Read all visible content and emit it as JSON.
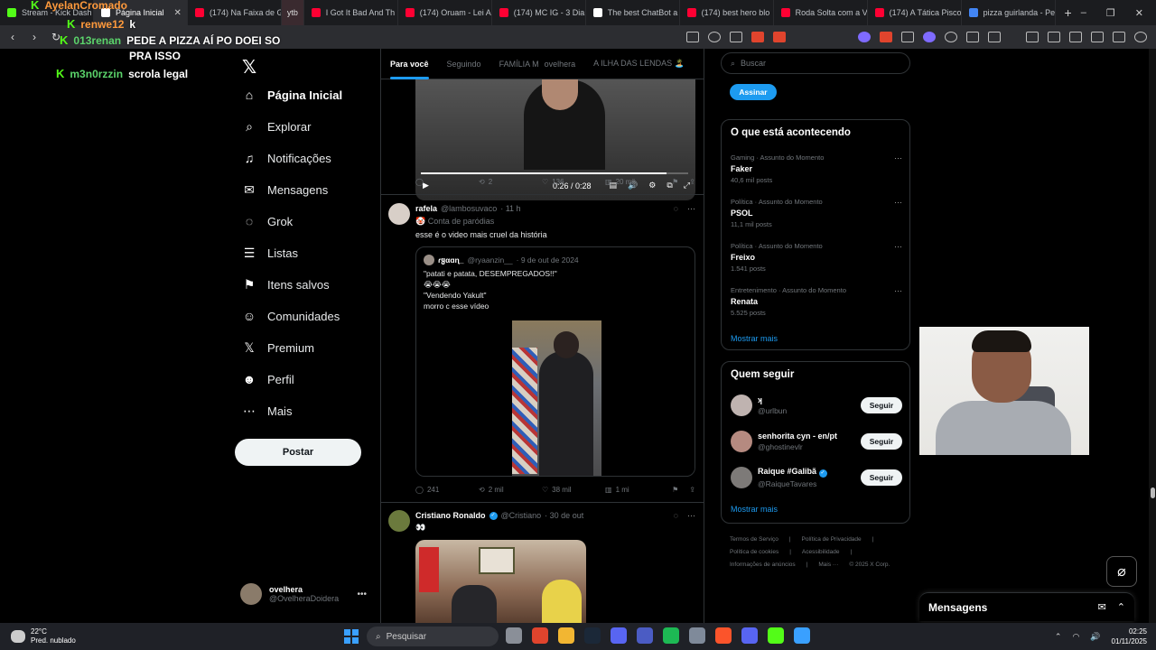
{
  "browser": {
    "tabs": [
      {
        "label": "Stream - Kick Dash",
        "color": "#53fc18"
      },
      {
        "label": "Página Inicial",
        "color": "#ffffff",
        "active": true
      },
      {
        "label": "(174) Na Faixa de G",
        "color": "#ff0033"
      },
      {
        "label": "ytb",
        "color": "#ff0033"
      },
      {
        "label": "I Got It Bad And Th",
        "color": "#ff0033"
      },
      {
        "label": "(174) Oruam - Lei A",
        "color": "#ff0033"
      },
      {
        "label": "(174) MC IG - 3 Dia",
        "color": "#ff0033"
      },
      {
        "label": "The best ChatBot a",
        "color": "#ffffff"
      },
      {
        "label": "(174) best hero blo",
        "color": "#ff0033"
      },
      {
        "label": "Roda Solta com a V",
        "color": "#ff0033"
      },
      {
        "label": "(174) A Tática Pisco",
        "color": "#ff0033"
      },
      {
        "label": "pizza guirlanda - Pe",
        "color": "#4285f4"
      }
    ],
    "new_tab": "+",
    "win_controls": [
      "–",
      "❐",
      "✕"
    ]
  },
  "chat": [
    {
      "user": "AyelanCromado",
      "message": "",
      "color": "orange"
    },
    {
      "user": "renwe12",
      "message": "k",
      "color": "orange"
    },
    {
      "user": "013renan",
      "message": "PEDE A PIZZA AÍ PO DOEI SO",
      "color": "green2"
    },
    {
      "user": "",
      "message": "PRA ISSO",
      "color": "green2"
    },
    {
      "user": "m3n0rzzin",
      "message": "scrola legal",
      "color": "green2"
    }
  ],
  "sidebar": {
    "items": [
      {
        "label": "Página Inicial",
        "icon": "home-icon",
        "glyph": "⌂"
      },
      {
        "label": "Explorar",
        "icon": "search-icon",
        "glyph": "⌕"
      },
      {
        "label": "Notificações",
        "icon": "bell-icon",
        "glyph": "♫"
      },
      {
        "label": "Mensagens",
        "icon": "mail-icon",
        "glyph": "✉"
      },
      {
        "label": "Grok",
        "icon": "grok-icon",
        "glyph": "◌"
      },
      {
        "label": "Listas",
        "icon": "list-icon",
        "glyph": "☰"
      },
      {
        "label": "Itens salvos",
        "icon": "bookmark-icon",
        "glyph": "⚑"
      },
      {
        "label": "Comunidades",
        "icon": "people-icon",
        "glyph": "☺"
      },
      {
        "label": "Premium",
        "icon": "x-premium-icon",
        "glyph": "𝕏"
      },
      {
        "label": "Perfil",
        "icon": "person-icon",
        "glyph": "☻"
      },
      {
        "label": "Mais",
        "icon": "more-circle-icon",
        "glyph": "⋯"
      }
    ],
    "post_button": "Postar",
    "profile": {
      "name": "ovelhera",
      "handle": "@OvelheraDoidera",
      "more": "•••"
    }
  },
  "feed": {
    "tabs": [
      "Para você",
      "Seguindo",
      "FAMÍLIA M",
      "ovelhera",
      "A ILHA DAS LENDAS 🏝️"
    ],
    "video1": {
      "time": "0:26 / 0:28",
      "progress": 0.92
    },
    "actions1": {
      "replies": "",
      "reposts": "2",
      "likes": "136",
      "views": "20 mil"
    },
    "tweet2": {
      "name": "rafela",
      "handle": "@lambosuvaco",
      "time": "· 11 h",
      "badge": "🤡 Conta de paródias",
      "text": "esse é o video mais cruel da história",
      "quote": {
        "name": "ɾყαɑɳ_",
        "handle": "@ryaanzin__",
        "date": "· 9 de out de 2024",
        "lines": [
          "\"patati e patata, DESEMPREGADOS!!\"",
          "😭😭😭",
          "\"Vendendo Yakult\"",
          "morro c esse vídeo"
        ]
      },
      "actions": {
        "replies": "241",
        "reposts": "2 mil",
        "likes": "38 mil",
        "views": "1 mi"
      }
    },
    "tweet3": {
      "name": "Cristiano Ronaldo",
      "handle": "@Cristiano",
      "time": "· 30 de out",
      "text": "👀"
    }
  },
  "right": {
    "search_placeholder": "Buscar",
    "subscribe": "Assinar",
    "trends_title": "O que está acontecendo",
    "trends": [
      {
        "category": "Gaming · Assunto do Momento",
        "title": "Faker",
        "count": "40,6 mil posts"
      },
      {
        "category": "Política · Assunto do Momento",
        "title": "PSOL",
        "count": "11,1 mil posts"
      },
      {
        "category": "Política · Assunto do Momento",
        "title": "Freixo",
        "count": "1.541 posts"
      },
      {
        "category": "Entretenimento · Assunto do Momento",
        "title": "Renata",
        "count": "5.525 posts"
      }
    ],
    "trends_more": "Mostrar mais",
    "follow_title": "Quem seguir",
    "follows": [
      {
        "name": "ʞ",
        "handle": "@urlbun",
        "button": "Seguir",
        "color": "#bfb3b0"
      },
      {
        "name": "senhorita cyn - en/pt",
        "handle": "@ghostinevlr",
        "button": "Seguir",
        "color": "#b58a80"
      },
      {
        "name": "Raique #Galibã",
        "handle": "@RaiqueTavares",
        "button": "Seguir",
        "color": "#7d7a78"
      }
    ],
    "follow_more": "Mostrar mais",
    "footer_rows": [
      [
        "Termos de Serviço",
        "|",
        "Política de Privacidade",
        "|"
      ],
      [
        "Política de cookies",
        "|",
        "Acessibilidade",
        "|"
      ],
      [
        "Informações de anúncios",
        "|",
        "Mais ···",
        "© 2025 X Corp."
      ]
    ]
  },
  "messages_bar": {
    "title": "Mensagens"
  },
  "taskbar": {
    "weather_temp": "22°C",
    "weather_desc": "Pred. nublado",
    "search": "Pesquisar",
    "time": "02:25",
    "date": "01/11/2025",
    "apps": [
      "#8a8f98",
      "#e0442d",
      "#f2b632",
      "#1b2838",
      "#5865f2",
      "#4b5cc4",
      "#1db954",
      "#7f8a9a",
      "#fb542b",
      "#5865f2",
      "#53fc18",
      "#3aa0ff"
    ]
  }
}
